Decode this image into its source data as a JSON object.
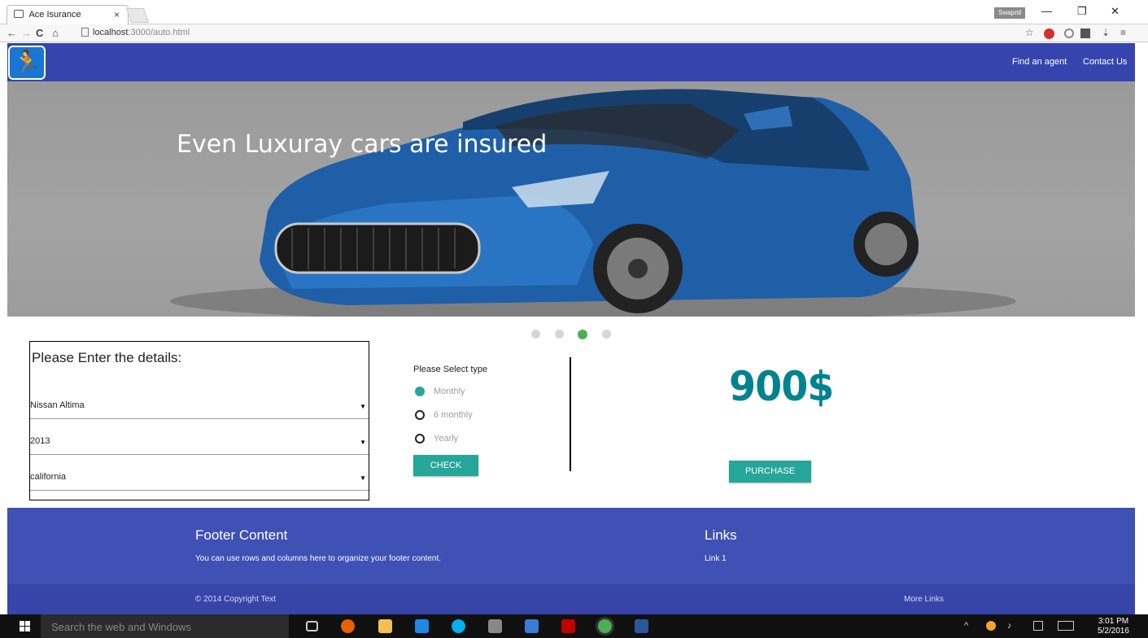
{
  "browser": {
    "tab_title": "Ace Isurance",
    "tab_close": "×",
    "user_badge": "Swapnil",
    "url_host": "localhost",
    "url_path": ":3000/auto.html",
    "back": "←",
    "forward": "→",
    "reload": "C",
    "home": "⌂",
    "minimize": "—",
    "restore": "❐",
    "close": "✕",
    "star": "☆",
    "menu": "≡"
  },
  "navbar": {
    "logo_glyph": "🏃",
    "links": [
      "Find an agent",
      "Contact Us"
    ]
  },
  "hero": {
    "caption": "Even Luxuray cars are insured",
    "active_slide_index": 2,
    "slide_count": 4
  },
  "form": {
    "title": "Please Enter the details:",
    "selects": [
      {
        "value": "Nissan Altima"
      },
      {
        "value": "2013"
      },
      {
        "value": "california"
      }
    ],
    "arrow": "▼"
  },
  "plan": {
    "label": "Please Select type",
    "options": [
      "Monthly",
      "6 monthly",
      "Yearly"
    ],
    "selected": "Monthly",
    "check_label": "CHECK"
  },
  "quote": {
    "price": "900$",
    "purchase_label": "PURCHASE"
  },
  "footer": {
    "heading": "Footer Content",
    "text": "You can use rows and columns here to organize your footer content.",
    "links_heading": "Links",
    "link1": "Link 1",
    "copyright": "© 2014 Copyright Text",
    "more_links": "More Links"
  },
  "taskbar": {
    "search_placeholder": "Search the web and Windows",
    "time": "3:01 PM",
    "date": "5/2/2016"
  },
  "colors": {
    "navbar": "#3645ae",
    "footer": "#3f51b5",
    "accent": "#26a69a",
    "price": "#00838f",
    "active_dot": "#4caf50"
  }
}
